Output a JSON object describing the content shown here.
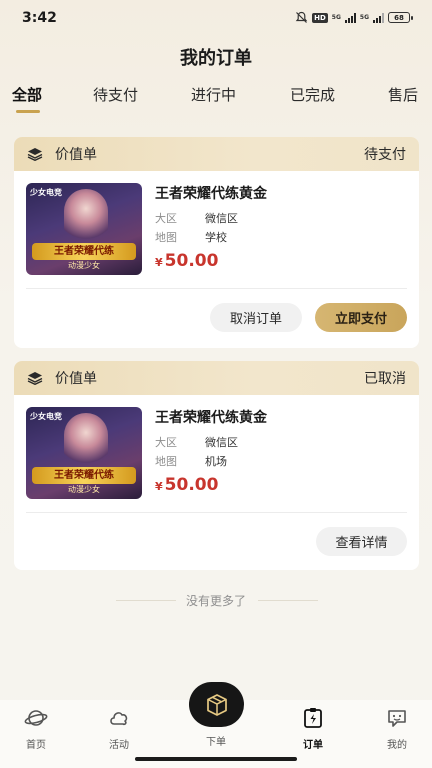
{
  "status_bar": {
    "time": "3:42",
    "hd": "HD",
    "net1": "5G",
    "net2": "5G",
    "battery": "68"
  },
  "header": {
    "title": "我的订单"
  },
  "tabs": [
    {
      "label": "全部",
      "active": true
    },
    {
      "label": "待支付",
      "active": false
    },
    {
      "label": "进行中",
      "active": false
    },
    {
      "label": "已完成",
      "active": false
    },
    {
      "label": "售后",
      "active": false
    }
  ],
  "orders": [
    {
      "type": "价值单",
      "status": "待支付",
      "thumb": {
        "tag": "少女电竞",
        "banner": "王者荣耀代练",
        "sub": "动漫少女"
      },
      "title": "王者荣耀代练黄金",
      "attrs": [
        {
          "label": "大区",
          "value": "微信区"
        },
        {
          "label": "地图",
          "value": "学校"
        }
      ],
      "currency": "¥",
      "price": "50.00",
      "buttons": [
        "取消订单",
        "立即支付"
      ]
    },
    {
      "type": "价值单",
      "status": "已取消",
      "thumb": {
        "tag": "少女电竞",
        "banner": "王者荣耀代练",
        "sub": "动漫少女"
      },
      "title": "王者荣耀代练黄金",
      "attrs": [
        {
          "label": "大区",
          "value": "微信区"
        },
        {
          "label": "地图",
          "value": "机场"
        }
      ],
      "currency": "¥",
      "price": "50.00",
      "buttons": [
        "查看详情"
      ]
    }
  ],
  "footer_note": "没有更多了",
  "tabbar": [
    {
      "label": "首页",
      "icon": "planet-icon"
    },
    {
      "label": "活动",
      "icon": "cloud-icon"
    },
    {
      "label": "下单",
      "icon": "box-icon"
    },
    {
      "label": "订单",
      "icon": "order-icon",
      "active": true
    },
    {
      "label": "我的",
      "icon": "chat-face-icon"
    }
  ],
  "colors": {
    "accent": "#c9a55b",
    "price": "#c8352d",
    "header_band": "#ecdcb8"
  }
}
